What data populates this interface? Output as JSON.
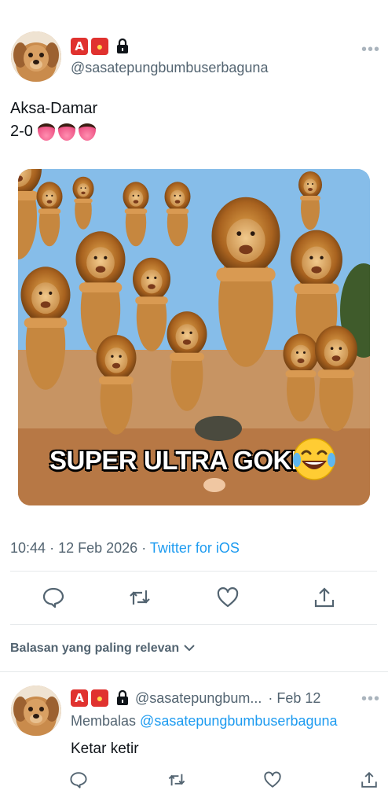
{
  "tweet": {
    "badges": [
      "🅰",
      "🚨"
    ],
    "handle": "@sasatepungbumbuserbaguna",
    "text_line1": "Aksa-Damar",
    "text_line2": "2-0",
    "emoji_count": 3,
    "meme": {
      "caption": "SUPER ULTRA GOKIL",
      "emoji": "😂"
    },
    "time": "10:44",
    "date": "12 Feb 2026",
    "separator": "·",
    "source": "Twitter for iOS"
  },
  "actions": [
    "reply-icon",
    "retweet-icon",
    "like-icon",
    "share-icon"
  ],
  "replies_sort": {
    "label": "Balasan yang paling relevan"
  },
  "reply": {
    "handle": "@sasatepungbum...",
    "date": "· Feb 12",
    "replying_label": "Membalas",
    "replying_to": "@sasatepungbumbuserbaguna",
    "text": "Ketar ketir"
  },
  "colors": {
    "accent": "#1d9bf0",
    "muted": "#536471",
    "text": "#0f1419",
    "badge": "#e0322f"
  }
}
